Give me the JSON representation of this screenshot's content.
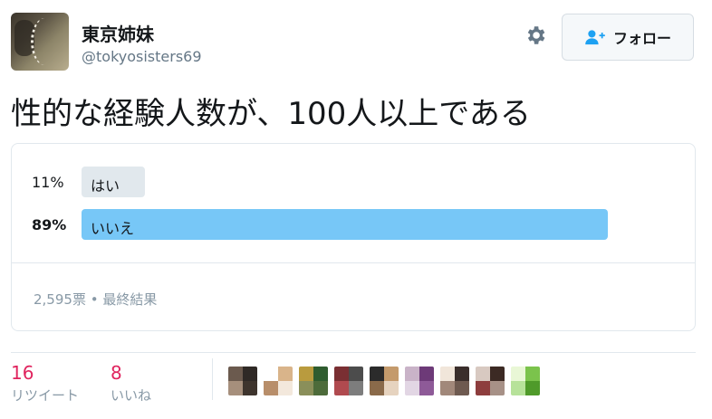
{
  "header": {
    "display_name": "東京姉妹",
    "screen_name": "@tokyosisters69",
    "follow_label": "フォロー",
    "icons": [
      "avatar",
      "gear-icon",
      "follow-person-plus-icon"
    ]
  },
  "tweet": {
    "text": "性的な経験人数が、100人以上である"
  },
  "poll": {
    "options": [
      {
        "label": "はい",
        "percent_text": "11%",
        "percent": 11,
        "winner": false
      },
      {
        "label": "いいえ",
        "percent_text": "89%",
        "percent": 89,
        "winner": true
      }
    ],
    "summary": "2,595票 • 最終結果",
    "colors": {
      "winner_bar": "#77c7f7",
      "other_bar": "#e1e8ed"
    }
  },
  "stats": {
    "retweets": {
      "count": "16",
      "label": "リツイート"
    },
    "likes": {
      "count": "8",
      "label": "いいね"
    }
  },
  "likers": [
    {
      "name": "liker-avatar-1"
    },
    {
      "name": "liker-avatar-2"
    },
    {
      "name": "liker-avatar-3"
    },
    {
      "name": "liker-avatar-4"
    },
    {
      "name": "liker-avatar-5"
    },
    {
      "name": "liker-avatar-6"
    },
    {
      "name": "liker-avatar-7"
    },
    {
      "name": "liker-avatar-8"
    },
    {
      "name": "liker-avatar-9"
    }
  ]
}
